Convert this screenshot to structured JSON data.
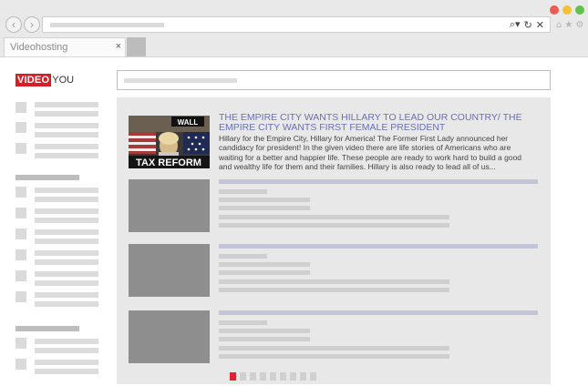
{
  "browser": {
    "tab_title": "Videohosting",
    "tab_close": "×",
    "nav_back": "‹",
    "nav_forward": "›",
    "address_icons": [
      "⌕▾",
      "↻",
      "✕"
    ],
    "toolbar_icons": [
      "⌂",
      "★",
      "⚙"
    ],
    "window_controls": {
      "close_color": "#ec5b53",
      "minimize_color": "#f5bf36",
      "maximize_color": "#5dc34a"
    }
  },
  "logo": {
    "video": "VIDEO",
    "you": "YOU"
  },
  "featured": {
    "title": "THE EMPIRE CITY WANTS HILLARY TO LEAD OUR COUNTRY/ THE EMPIRE CITY WANTS FIRST FEMALE PRESIDENT",
    "description": "Hillary for the Empire City, Hillary for America! The Former First Lady announced her candidacy for president! In the given video there are life stories of Americans who are waiting for a better and happier life. These people are ready to work hard to build a good and wealthy life for them and their families. Hillary is also ready to lead all of us...",
    "thumb_sign": "WALL",
    "thumb_banner": "TAX REFORM"
  },
  "pagination": {
    "count": 9,
    "active_index": 0
  },
  "colors": {
    "accent": "#d71e28",
    "title_link": "#6870b3"
  }
}
